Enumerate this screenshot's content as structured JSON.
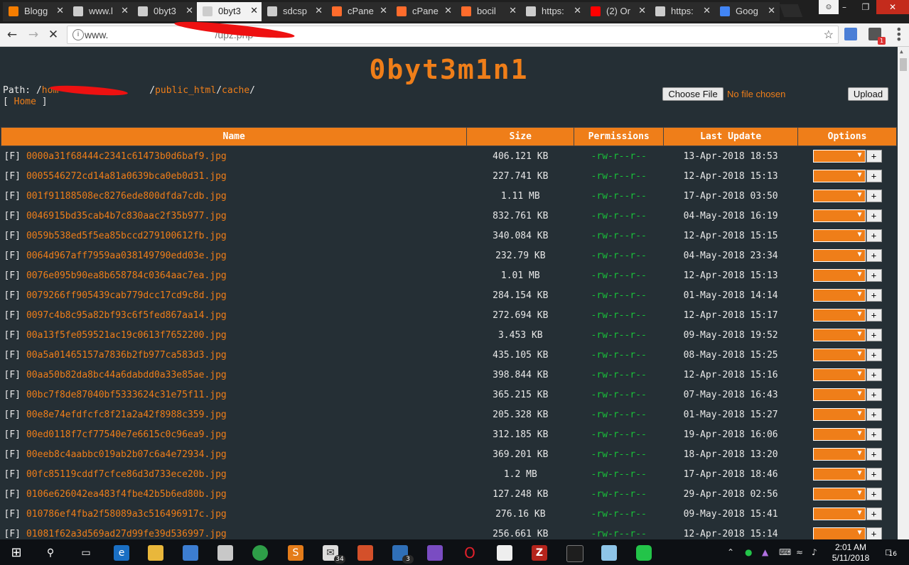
{
  "browser": {
    "tabs": [
      {
        "label": "Blogg",
        "icon": "blogger-icon",
        "color": "#f57d00"
      },
      {
        "label": "www.l",
        "icon": "page-icon",
        "color": "#cccccc"
      },
      {
        "label": "0byt3",
        "icon": "page-icon",
        "color": "#cccccc"
      },
      {
        "label": "0byt3",
        "icon": "loading-icon",
        "color": "#cccccc"
      },
      {
        "label": "sdcsp",
        "icon": "page-icon",
        "color": "#cccccc"
      },
      {
        "label": "cPane",
        "icon": "cpanel-icon",
        "color": "#ff6c2c"
      },
      {
        "label": "cPane",
        "icon": "cpanel-icon",
        "color": "#ff6c2c"
      },
      {
        "label": "bocil",
        "icon": "cpanel-icon",
        "color": "#ff6c2c"
      },
      {
        "label": "https:",
        "icon": "grid-icon",
        "color": "#cccccc"
      },
      {
        "label": "(2) Or",
        "icon": "youtube-icon",
        "color": "#ff0000"
      },
      {
        "label": "https:",
        "icon": "grid-icon",
        "color": "#cccccc"
      },
      {
        "label": "Goog",
        "icon": "google-icon",
        "color": "#4285f4"
      }
    ],
    "active_tab_index": 3,
    "url_prefix": "www.",
    "url_suffix": "/upz.php",
    "extension_badge": "1"
  },
  "shell": {
    "title": "0byt3m1n1",
    "path_label": "Path:",
    "path_segments": [
      "/",
      "hom",
      "/",
      "public_html",
      "/",
      "cache",
      "/"
    ],
    "home_link": "Home",
    "choose_file": "Choose File",
    "no_file": "No file chosen",
    "upload": "Upload"
  },
  "table": {
    "headers": [
      "Name",
      "Size",
      "Permissions",
      "Last Update",
      "Options"
    ],
    "file_tag": "[F]",
    "rows": [
      {
        "name": "0000a31f68444c2341c61473b0d6baf9.jpg",
        "size": "406.121 KB",
        "perm": "-rw-r--r--",
        "date": "13-Apr-2018 18:53"
      },
      {
        "name": "0005546272cd14a81a0639bca0eb0d31.jpg",
        "size": "227.741 KB",
        "perm": "-rw-r--r--",
        "date": "12-Apr-2018 15:13"
      },
      {
        "name": "001f91188508ec8276ede800dfda7cdb.jpg",
        "size": "1.11 MB",
        "perm": "-rw-r--r--",
        "date": "17-Apr-2018 03:50"
      },
      {
        "name": "0046915bd35cab4b7c830aac2f35b977.jpg",
        "size": "832.761 KB",
        "perm": "-rw-r--r--",
        "date": "04-May-2018 16:19"
      },
      {
        "name": "0059b538ed5f5ea85bccd279100612fb.jpg",
        "size": "340.084 KB",
        "perm": "-rw-r--r--",
        "date": "12-Apr-2018 15:15"
      },
      {
        "name": "0064d967aff7959aa038149790edd03e.jpg",
        "size": "232.79 KB",
        "perm": "-rw-r--r--",
        "date": "04-May-2018 23:34"
      },
      {
        "name": "0076e095b90ea8b658784c0364aac7ea.jpg",
        "size": "1.01 MB",
        "perm": "-rw-r--r--",
        "date": "12-Apr-2018 15:13"
      },
      {
        "name": "0079266ff905439cab779dcc17cd9c8d.jpg",
        "size": "284.154 KB",
        "perm": "-rw-r--r--",
        "date": "01-May-2018 14:14"
      },
      {
        "name": "0097c4b8c95a82bf93c6f5fed867aa14.jpg",
        "size": "272.694 KB",
        "perm": "-rw-r--r--",
        "date": "12-Apr-2018 15:17"
      },
      {
        "name": "00a13f5fe059521ac19c0613f7652200.jpg",
        "size": "3.453 KB",
        "perm": "-rw-r--r--",
        "date": "09-May-2018 19:52"
      },
      {
        "name": "00a5a01465157a7836b2fb977ca583d3.jpg",
        "size": "435.105 KB",
        "perm": "-rw-r--r--",
        "date": "08-May-2018 15:25"
      },
      {
        "name": "00aa50b82da8bc44a6dabdd0a33e85ae.jpg",
        "size": "398.844 KB",
        "perm": "-rw-r--r--",
        "date": "12-Apr-2018 15:16"
      },
      {
        "name": "00bc7f8de87040bf5333624c31e75f11.jpg",
        "size": "365.215 KB",
        "perm": "-rw-r--r--",
        "date": "07-May-2018 16:43"
      },
      {
        "name": "00e8e74efdfcfc8f21a2a42f8988c359.jpg",
        "size": "205.328 KB",
        "perm": "-rw-r--r--",
        "date": "01-May-2018 15:27"
      },
      {
        "name": "00ed0118f7cf77540e7e6615c0c96ea9.jpg",
        "size": "312.185 KB",
        "perm": "-rw-r--r--",
        "date": "19-Apr-2018 16:06"
      },
      {
        "name": "00eeb8c4aabbc019ab2b07c6a4e72934.jpg",
        "size": "369.201 KB",
        "perm": "-rw-r--r--",
        "date": "18-Apr-2018 13:20"
      },
      {
        "name": "00fc85119cddf7cfce86d3d733ece20b.jpg",
        "size": "1.2 MB",
        "perm": "-rw-r--r--",
        "date": "17-Apr-2018 18:46"
      },
      {
        "name": "0106e626042ea483f4fbe42b5b6ed80b.jpg",
        "size": "127.248 KB",
        "perm": "-rw-r--r--",
        "date": "29-Apr-2018 02:56"
      },
      {
        "name": "010786ef4fba2f58089a3c516496917c.jpg",
        "size": "276.16 KB",
        "perm": "-rw-r--r--",
        "date": "09-May-2018 15:41"
      },
      {
        "name": "01081f62a3d569ad27d99fe39d536997.jpg",
        "size": "256.661 KB",
        "perm": "-rw-r--r--",
        "date": "12-Apr-2018 15:14"
      }
    ],
    "plus_label": "+"
  },
  "taskbar": {
    "badges": {
      "mail": "34",
      "outlook": "3"
    },
    "time": "2:01 AM",
    "date": "5/11/2018",
    "notification_count": "16"
  },
  "colors": {
    "accent": "#ef7e19",
    "page_bg": "#252f35",
    "perm_green": "#19c23a"
  }
}
